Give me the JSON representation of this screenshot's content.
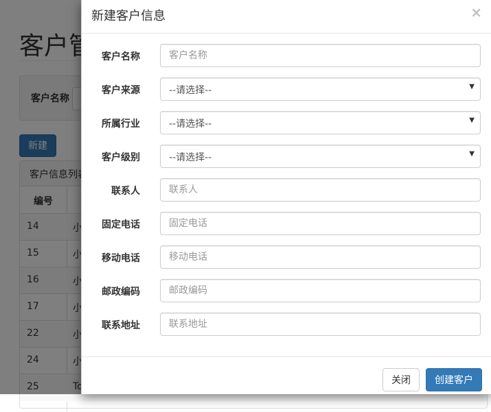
{
  "background": {
    "page_title": "客户管理",
    "search_label": "客户名称",
    "new_button": "新建",
    "panel_heading": "客户信息列表",
    "table_header_id": "编号",
    "rows": [
      {
        "id": "14",
        "name": "小"
      },
      {
        "id": "15",
        "name": "小"
      },
      {
        "id": "16",
        "name": "小"
      },
      {
        "id": "17",
        "name": "小"
      },
      {
        "id": "22",
        "name": "小"
      },
      {
        "id": "24",
        "name": "小"
      },
      {
        "id": "25",
        "name": "To"
      }
    ]
  },
  "modal": {
    "title": "新建客户信息",
    "close_symbol": "×",
    "fields": {
      "name": {
        "label": "客户名称",
        "placeholder": "客户名称"
      },
      "source": {
        "label": "客户来源",
        "selected": "--请选择--"
      },
      "industry": {
        "label": "所属行业",
        "selected": "--请选择--"
      },
      "level": {
        "label": "客户级别",
        "selected": "--请选择--"
      },
      "contact": {
        "label": "联系人",
        "placeholder": "联系人"
      },
      "phone": {
        "label": "固定电话",
        "placeholder": "固定电话"
      },
      "mobile": {
        "label": "移动电话",
        "placeholder": "移动电话"
      },
      "zipcode": {
        "label": "邮政编码",
        "placeholder": "邮政编码"
      },
      "address": {
        "label": "联系地址",
        "placeholder": "联系地址"
      }
    },
    "footer": {
      "close_button": "关闭",
      "create_button": "创建客户"
    }
  },
  "colors": {
    "primary": "#337ab7",
    "backdrop": "rgba(0,0,0,0.5)"
  }
}
